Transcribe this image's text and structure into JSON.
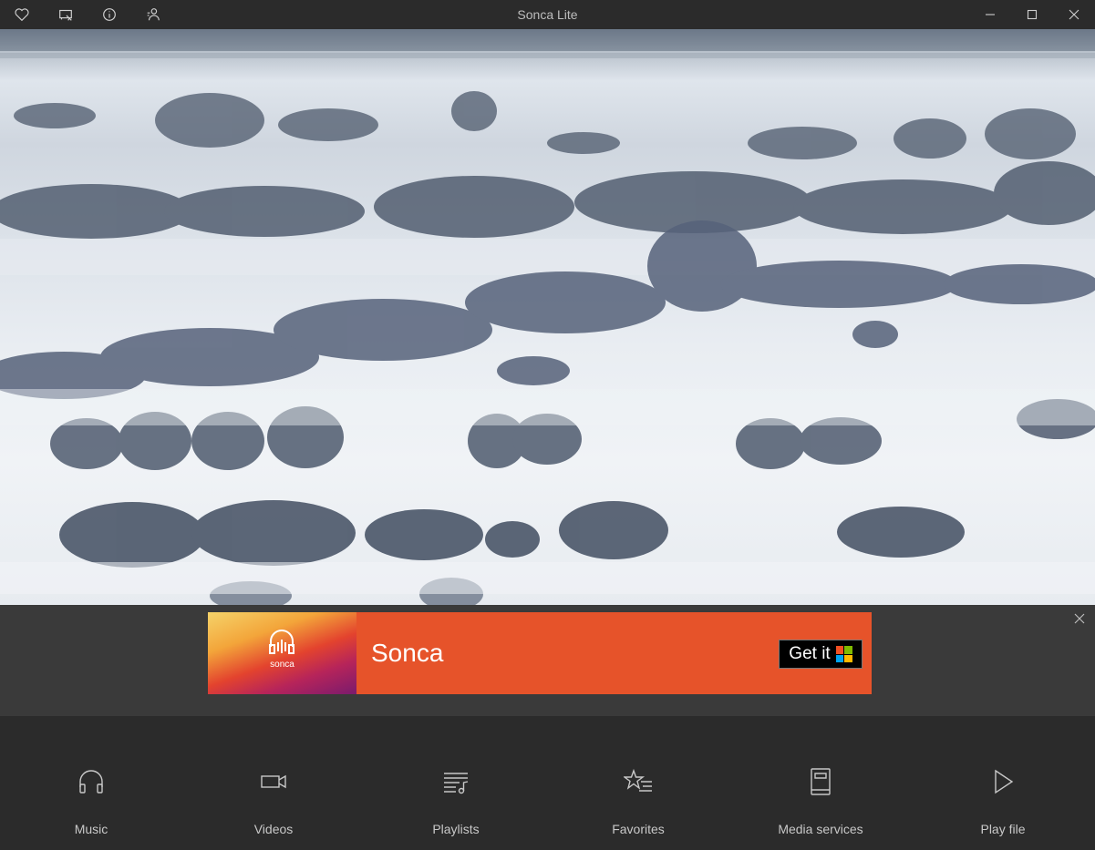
{
  "window": {
    "title": "Sonca Lite"
  },
  "toolbar": {
    "icons": [
      "heart-icon",
      "cast-icon",
      "info-icon",
      "user-icon"
    ]
  },
  "hero": {
    "description_icon": "landscape-image"
  },
  "ad": {
    "logo_text": "sonca",
    "name": "Sonca",
    "cta_label": "Get it",
    "colors": {
      "background": "#e6532a",
      "cta_background": "#000000"
    }
  },
  "nav": {
    "items": [
      {
        "label": "Music",
        "icon": "headphones-icon"
      },
      {
        "label": "Videos",
        "icon": "video-camera-icon"
      },
      {
        "label": "Playlists",
        "icon": "playlist-icon"
      },
      {
        "label": "Favorites",
        "icon": "star-list-icon"
      },
      {
        "label": "Media services",
        "icon": "book-icon"
      },
      {
        "label": "Play file",
        "icon": "play-icon"
      }
    ]
  }
}
